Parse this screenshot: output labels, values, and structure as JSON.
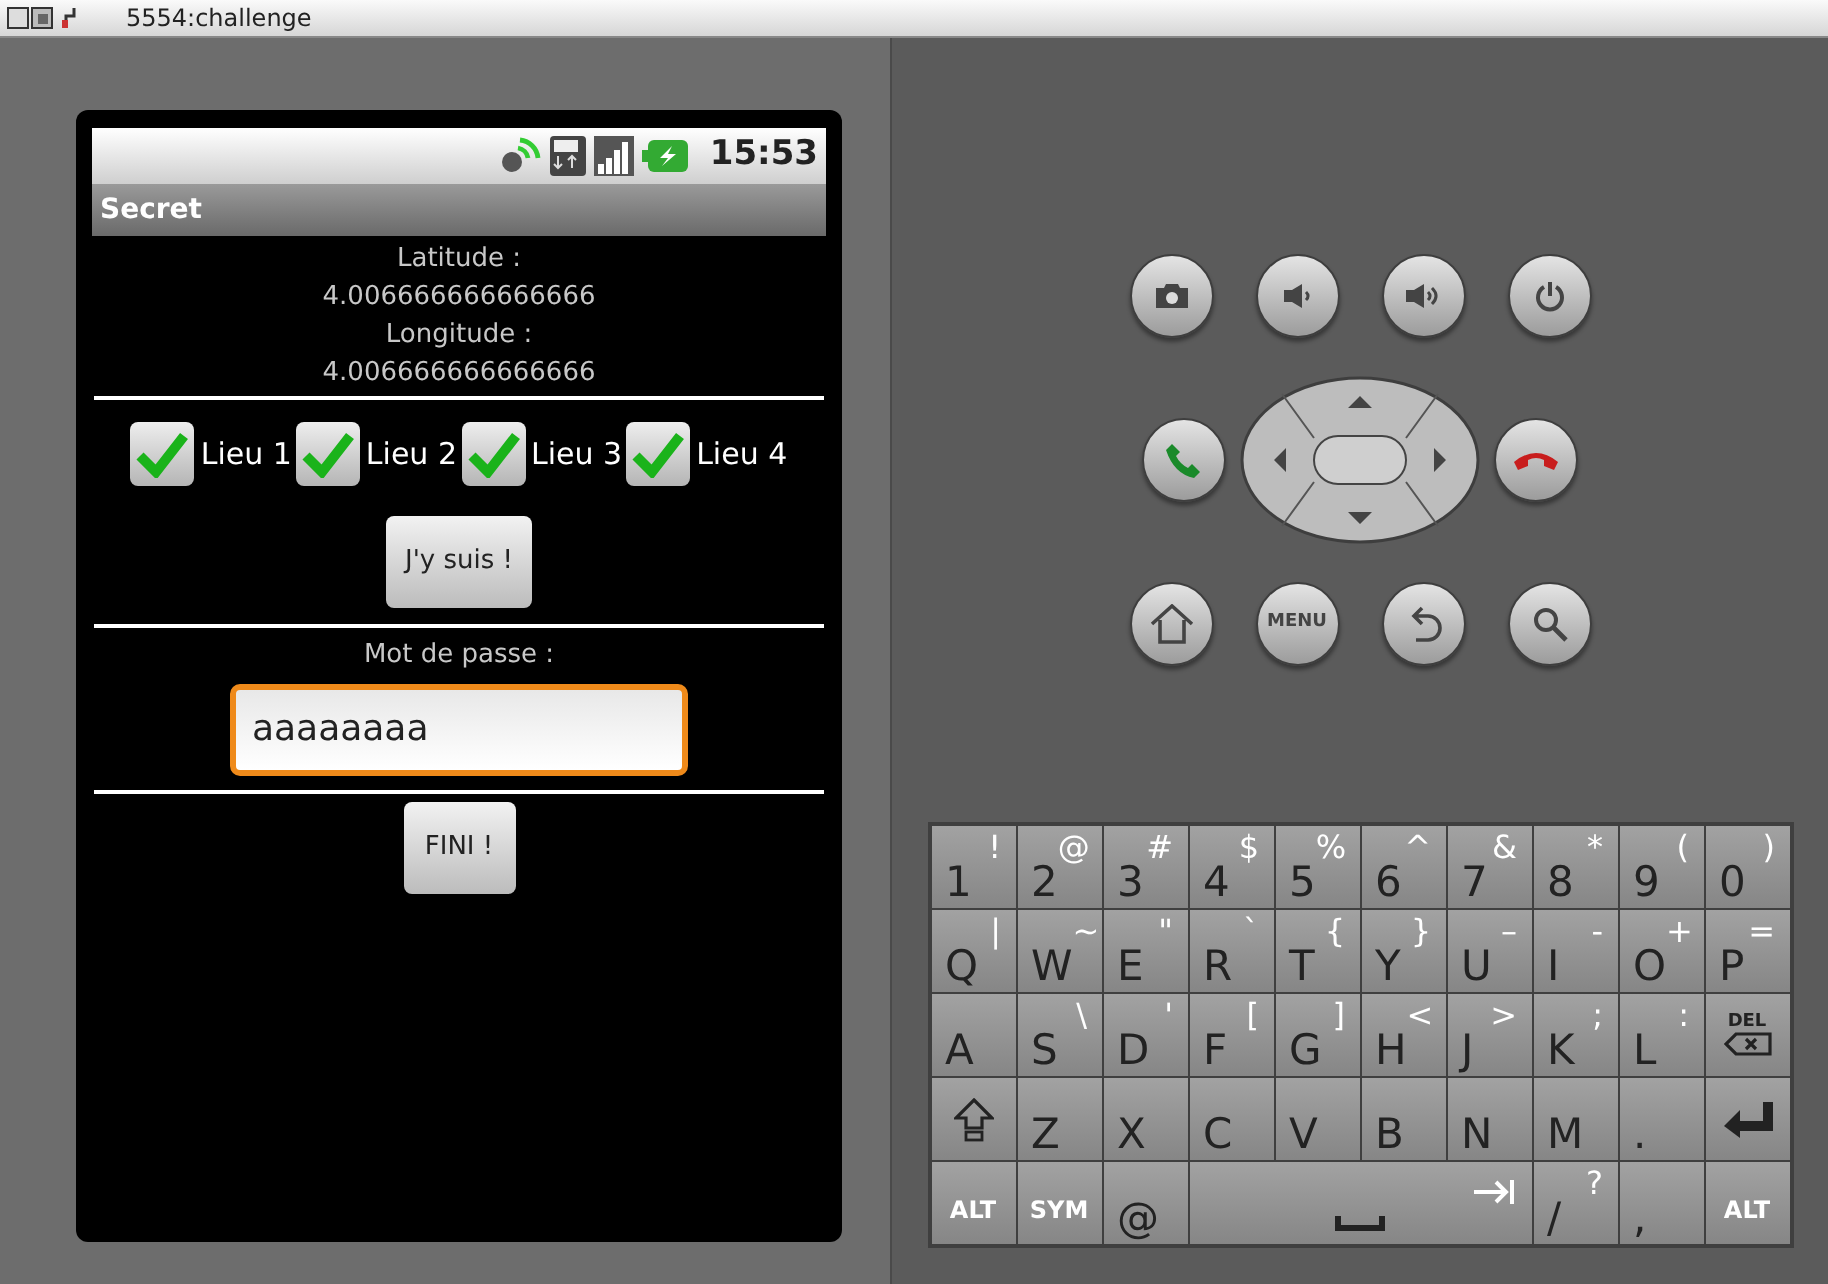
{
  "window": {
    "title": "5554:challenge"
  },
  "status_bar": {
    "time": "15:53"
  },
  "app_bar": {
    "title": "Secret"
  },
  "location": [
    {
      "label": "Latitude :",
      "value": "4.006666666666666"
    },
    {
      "label": "Longitude :",
      "value": "4.006666666666666"
    }
  ],
  "places": [
    {
      "label": "Lieu 1",
      "checked": true
    },
    {
      "label": "Lieu 2",
      "checked": true
    },
    {
      "label": "Lieu 3",
      "checked": true
    },
    {
      "label": "Lieu 4",
      "checked": true
    }
  ],
  "check_button": "J'y suis !",
  "password": {
    "label": "Mot de passe :",
    "value": "aaaaaaaa",
    "focused": true
  },
  "finish_button": "FINI !",
  "menu_key": "MENU",
  "keyboard": {
    "rows": [
      {
        "keys": [
          {
            "kind": "char",
            "main": "1",
            "alt": "!"
          },
          {
            "kind": "char",
            "main": "2",
            "alt": "@"
          },
          {
            "kind": "char",
            "main": "3",
            "alt": "#"
          },
          {
            "kind": "char",
            "main": "4",
            "alt": "$"
          },
          {
            "kind": "char",
            "main": "5",
            "alt": "%"
          },
          {
            "kind": "char",
            "main": "6",
            "alt": "^"
          },
          {
            "kind": "char",
            "main": "7",
            "alt": "&"
          },
          {
            "kind": "char",
            "main": "8",
            "alt": "*"
          },
          {
            "kind": "char",
            "main": "9",
            "alt": "("
          },
          {
            "kind": "char",
            "main": "0",
            "alt": ")"
          }
        ]
      },
      {
        "keys": [
          {
            "kind": "char",
            "main": "Q",
            "alt": "|"
          },
          {
            "kind": "char",
            "main": "W",
            "alt": "~"
          },
          {
            "kind": "char",
            "main": "E",
            "alt": "\""
          },
          {
            "kind": "char",
            "main": "R",
            "alt": "`"
          },
          {
            "kind": "char",
            "main": "T",
            "alt": "{"
          },
          {
            "kind": "char",
            "main": "Y",
            "alt": "}"
          },
          {
            "kind": "char",
            "main": "U",
            "alt": "–"
          },
          {
            "kind": "char",
            "main": "I",
            "alt": "-"
          },
          {
            "kind": "char",
            "main": "O",
            "alt": "+"
          },
          {
            "kind": "char",
            "main": "P",
            "alt": "="
          }
        ]
      },
      {
        "keys": [
          {
            "kind": "char",
            "main": "A"
          },
          {
            "kind": "char",
            "main": "S",
            "alt": "\\"
          },
          {
            "kind": "char",
            "main": "D",
            "alt": "'"
          },
          {
            "kind": "char",
            "main": "F",
            "alt": "["
          },
          {
            "kind": "char",
            "main": "G",
            "alt": "]"
          },
          {
            "kind": "char",
            "main": "H",
            "alt": "<"
          },
          {
            "kind": "char",
            "main": "J",
            "alt": ">"
          },
          {
            "kind": "char",
            "main": "K",
            "alt": ";"
          },
          {
            "kind": "char",
            "main": "L",
            "alt": ":"
          },
          {
            "kind": "delete",
            "main": "DEL"
          }
        ]
      },
      {
        "keys": [
          {
            "kind": "shift"
          },
          {
            "kind": "char",
            "main": "Z"
          },
          {
            "kind": "char",
            "main": "X"
          },
          {
            "kind": "char",
            "main": "C"
          },
          {
            "kind": "char",
            "main": "V"
          },
          {
            "kind": "char",
            "main": "B"
          },
          {
            "kind": "char",
            "main": "N"
          },
          {
            "kind": "char",
            "main": "M"
          },
          {
            "kind": "char",
            "main": "."
          },
          {
            "kind": "enter"
          }
        ]
      },
      {
        "keys": [
          {
            "kind": "modifier",
            "main": "ALT"
          },
          {
            "kind": "modifier",
            "main": "SYM"
          },
          {
            "kind": "char",
            "main": "@"
          },
          {
            "kind": "space"
          },
          {
            "kind": "char",
            "main": "/",
            "alt": "?"
          },
          {
            "kind": "char",
            "main": ","
          },
          {
            "kind": "modifier",
            "main": "ALT"
          }
        ]
      }
    ]
  }
}
